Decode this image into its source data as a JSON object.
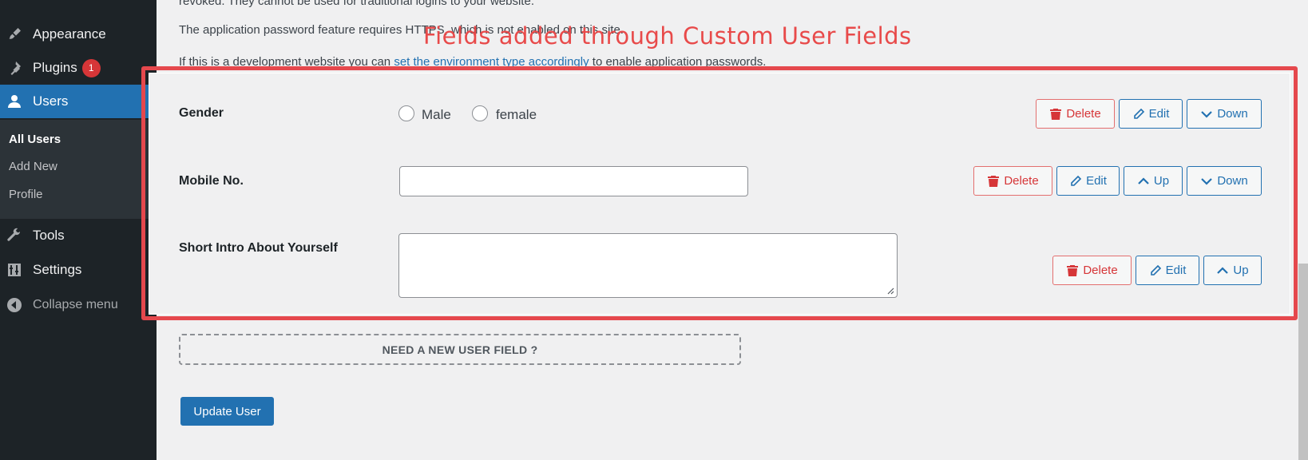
{
  "sidebar": {
    "items": [
      {
        "label": "Appearance",
        "icon": "brush-icon"
      },
      {
        "label": "Plugins",
        "icon": "plug-icon",
        "badge": "1"
      },
      {
        "label": "Users",
        "icon": "user-icon"
      },
      {
        "label": "Tools",
        "icon": "wrench-icon"
      },
      {
        "label": "Settings",
        "icon": "sliders-icon"
      }
    ],
    "submenu": [
      "All Users",
      "Add New",
      "Profile"
    ],
    "collapse_label": "Collapse menu"
  },
  "content": {
    "line1": "revoked. They cannot be used for traditional logins to your website.",
    "line2": "The application password feature requires HTTPS, which is not enabled on this site.",
    "line3_prefix": "If this is a development website you can ",
    "line3_link": "set the environment type accordingly",
    "line3_suffix": " to enable application passwords."
  },
  "annotation": "Fields added through Custom User Fields",
  "fields": [
    {
      "label": "Gender",
      "options": [
        "Male",
        "female"
      ]
    },
    {
      "label": "Mobile No.",
      "value": ""
    },
    {
      "label": "Short Intro About Yourself",
      "value": ""
    }
  ],
  "buttons": {
    "delete": "Delete",
    "edit": "Edit",
    "up": "Up",
    "down": "Down"
  },
  "new_field_label": "NEED A NEW USER FIELD ?",
  "update_label": "Update User",
  "colors": {
    "sidebar": "#1d2327",
    "accent": "#2271b1",
    "danger": "#d63638",
    "annotation": "#e5484d"
  }
}
